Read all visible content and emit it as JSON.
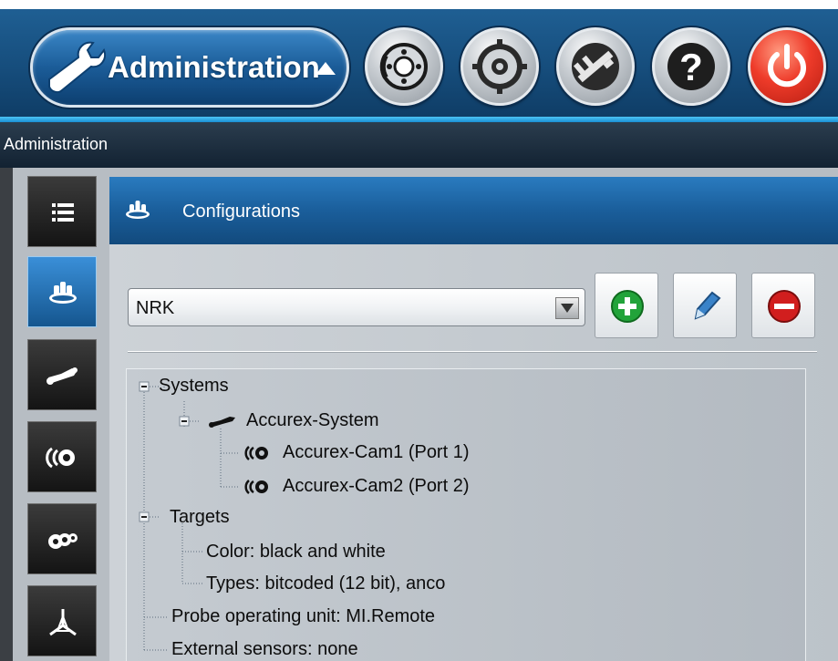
{
  "header": {
    "menu_label": "Administration",
    "buttons": [
      {
        "name": "disc-brake-icon"
      },
      {
        "name": "gear-icon"
      },
      {
        "name": "caliper-icon"
      },
      {
        "name": "help-icon"
      },
      {
        "name": "power-icon"
      }
    ]
  },
  "titlebar": {
    "title": "Administration"
  },
  "sidebar": {
    "items": [
      {
        "name": "list-icon",
        "active": false
      },
      {
        "name": "configuration-icon",
        "active": true
      },
      {
        "name": "system-icon",
        "active": false
      },
      {
        "name": "camera-icon",
        "active": false
      },
      {
        "name": "targets-icon",
        "active": false
      },
      {
        "name": "axes-icon",
        "active": false
      }
    ]
  },
  "panel": {
    "title": "Configurations",
    "dropdown_value": "NRK",
    "actions": [
      "add-icon",
      "edit-icon",
      "remove-icon"
    ]
  },
  "tree": {
    "systems": "Systems",
    "system": "Accurex-System",
    "cam1": "Accurex-Cam1 (Port 1)",
    "cam2": "Accurex-Cam2 (Port 2)",
    "targets": "Targets",
    "color": "Color: black and white",
    "types": "Types: bitcoded (12 bit), anco",
    "probe": "Probe operating unit: MI.Remote",
    "sensors": "External sensors: none"
  },
  "colors": {
    "header_blue": "#1a5e9b",
    "accent_cyan": "#4cc4f5",
    "add_green": "#22a33a",
    "remove_red": "#d11e1e",
    "power_red": "#ee3b2a"
  }
}
